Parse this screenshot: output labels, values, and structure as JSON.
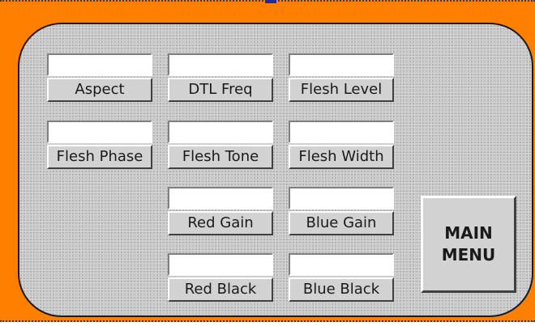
{
  "fields": {
    "aspect": {
      "label": "Aspect",
      "value": ""
    },
    "dtl_freq": {
      "label": "DTL Freq",
      "value": ""
    },
    "flesh_level": {
      "label": "Flesh Level",
      "value": ""
    },
    "flesh_phase": {
      "label": "Flesh Phase",
      "value": ""
    },
    "flesh_tone": {
      "label": "Flesh Tone",
      "value": ""
    },
    "flesh_width": {
      "label": "Flesh Width",
      "value": ""
    },
    "red_gain": {
      "label": "Red Gain",
      "value": ""
    },
    "blue_gain": {
      "label": "Blue Gain",
      "value": ""
    },
    "red_black": {
      "label": "Red Black",
      "value": ""
    },
    "blue_black": {
      "label": "Blue Black",
      "value": ""
    }
  },
  "main_menu": {
    "line1": "MAIN",
    "line2": "MENU"
  },
  "colors": {
    "frame": "#ff7f00",
    "panel": "#c8c8c8",
    "button_face": "#d2d2d2"
  }
}
